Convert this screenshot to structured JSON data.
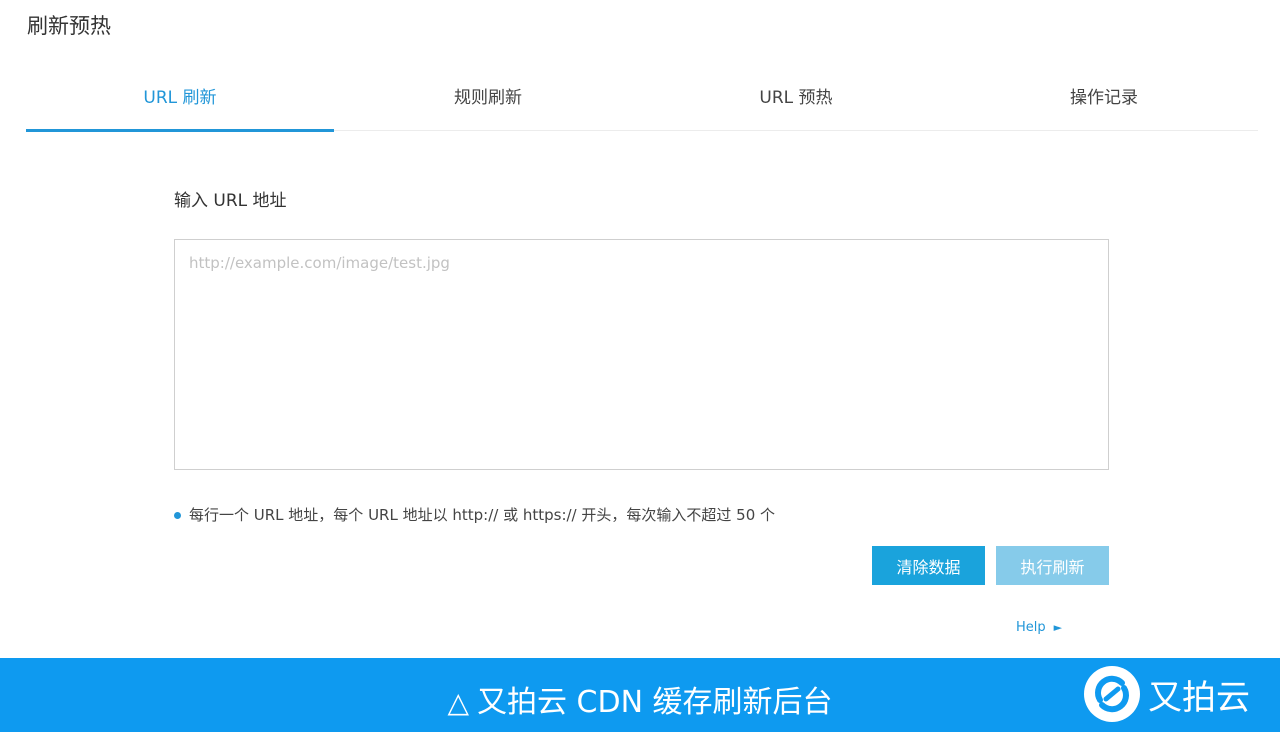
{
  "page": {
    "title": "刷新预热"
  },
  "tabs": [
    {
      "label": "URL 刷新",
      "active": true
    },
    {
      "label": "规则刷新",
      "active": false
    },
    {
      "label": "URL 预热",
      "active": false
    },
    {
      "label": "操作记录",
      "active": false
    }
  ],
  "form": {
    "label": "输入 URL 地址",
    "placeholder": "http://example.com/image/test.jpg",
    "value": "",
    "hint": "每行一个 URL 地址，每个 URL 地址以 http:// 或 https:// 开头，每次输入不超过 50 个"
  },
  "buttons": {
    "clear_label": "清除数据",
    "execute_label": "执行刷新"
  },
  "help": {
    "label": "Help",
    "arrow": "►"
  },
  "footer": {
    "warning_symbol": "△",
    "caption": "又拍云 CDN 缓存刷新后台",
    "brand_name": "又拍云"
  },
  "colors": {
    "accent": "#2196d8",
    "footer_bg": "#0e9af0",
    "button_primary": "#1aa3dc",
    "button_disabled": "#86cbea"
  }
}
